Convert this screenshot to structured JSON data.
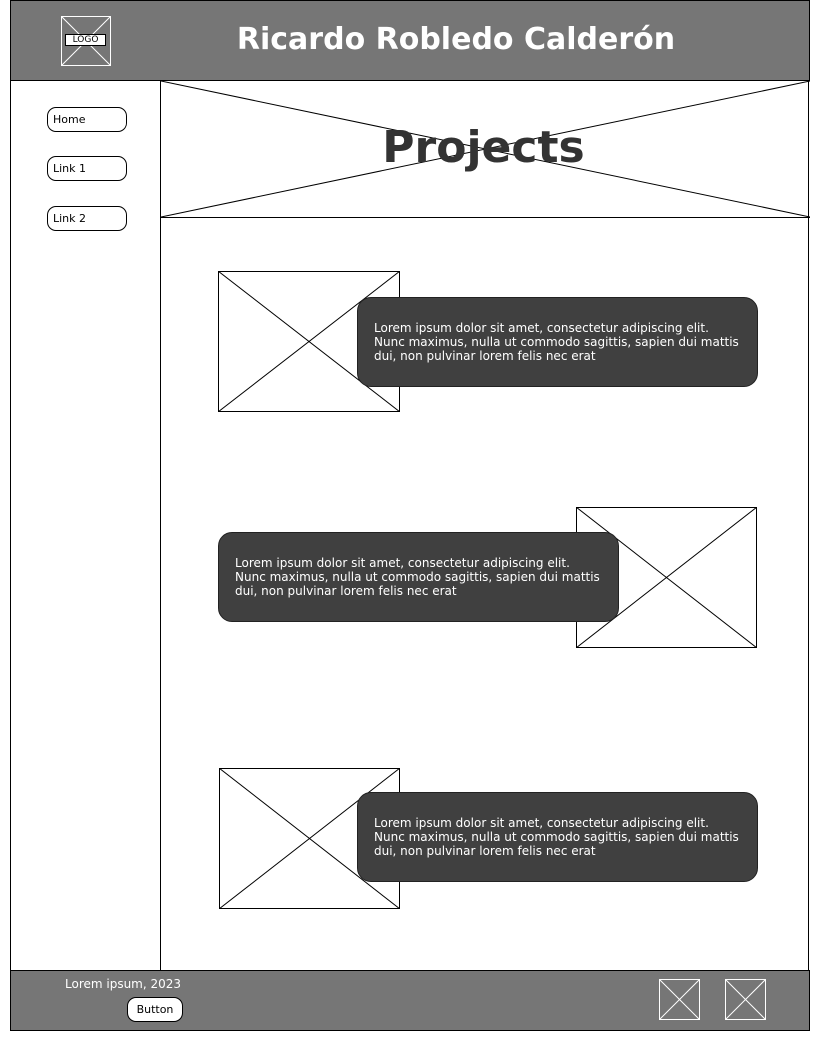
{
  "header": {
    "logo_label": "LOGO",
    "title": "Ricardo Robledo Calderón"
  },
  "sidebar": {
    "items": [
      {
        "label": "Home"
      },
      {
        "label": "Link 1"
      },
      {
        "label": "Link 2"
      }
    ]
  },
  "main": {
    "page_title": "Projects",
    "projects": [
      {
        "description": "Lorem ipsum dolor sit amet, consectetur adipiscing elit. Nunc maximus, nulla ut commodo sagittis, sapien dui mattis dui, non pulvinar lorem felis nec erat"
      },
      {
        "description": "Lorem ipsum dolor sit amet, consectetur adipiscing elit. Nunc maximus, nulla ut commodo sagittis, sapien dui mattis dui, non pulvinar lorem felis nec erat"
      },
      {
        "description": "Lorem ipsum dolor sit amet, consectetur adipiscing elit. Nunc maximus, nulla ut commodo sagittis, sapien dui mattis dui, non pulvinar lorem felis nec erat"
      }
    ]
  },
  "footer": {
    "copyright": "Lorem ipsum, 2023",
    "button_label": "Button"
  },
  "colors": {
    "header_bg": "#767676",
    "card_bg": "#404040",
    "title_text": "#333333"
  }
}
